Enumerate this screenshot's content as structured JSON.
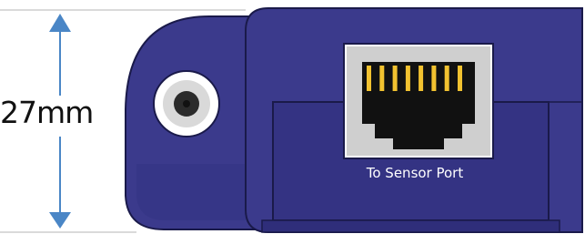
{
  "dimension": {
    "value_label": "27mm"
  },
  "port": {
    "label": "To Sensor Port",
    "pin_count": 8
  },
  "colors": {
    "body": "#3b3a8c",
    "body_dark": "#2a2970",
    "outline": "#1a1a4a",
    "arrow": "#4a86c6",
    "jack_face": "#ffffff",
    "pins": "#f2c230"
  },
  "icons": {
    "dc_jack": "dc-power-jack-icon",
    "rj45": "rj45-socket-icon"
  }
}
